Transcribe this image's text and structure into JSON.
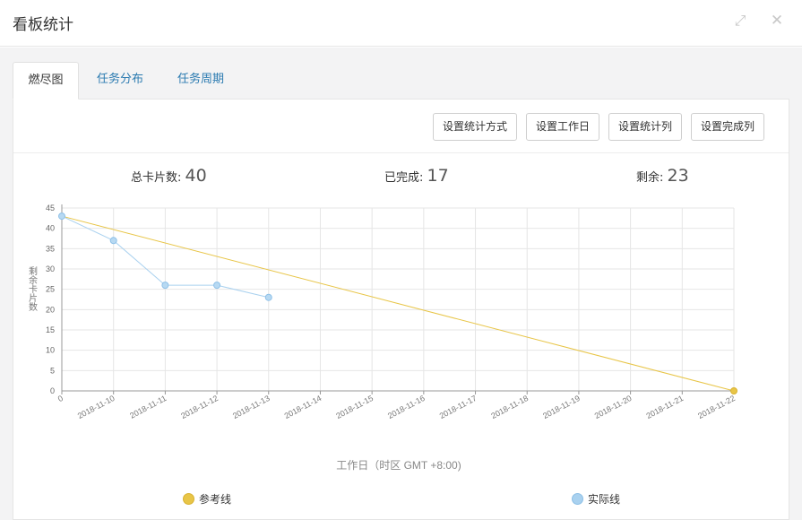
{
  "window": {
    "title": "看板统计",
    "expand_icon": "expand-arrows-icon",
    "close_icon": "close-icon"
  },
  "tabs": [
    {
      "label": "燃尽图",
      "active": true
    },
    {
      "label": "任务分布",
      "active": false
    },
    {
      "label": "任务周期",
      "active": false
    }
  ],
  "toolbar": {
    "stat_method": "设置统计方式",
    "workday": "设置工作日",
    "stat_column": "设置统计列",
    "done_column": "设置完成列"
  },
  "stats": {
    "total_label": "总卡片数:",
    "total_value": "40",
    "done_label": "已完成:",
    "done_value": "17",
    "remaining_label": "剩余:",
    "remaining_value": "23"
  },
  "chart_data": {
    "type": "line",
    "xlabel": "工作日（时区 GMT +8:00)",
    "ylabel": "剩余卡片数",
    "ylim": [
      0,
      45
    ],
    "yticks": [
      0,
      5,
      10,
      15,
      20,
      25,
      30,
      35,
      40,
      45
    ],
    "categories": [
      "0",
      "2018-11-10",
      "2018-11-11",
      "2018-11-12",
      "2018-11-13",
      "2018-11-14",
      "2018-11-15",
      "2018-11-16",
      "2018-11-17",
      "2018-11-18",
      "2018-11-19",
      "2018-11-20",
      "2018-11-21",
      "2018-11-22"
    ],
    "grid": true,
    "legend_position": "bottom",
    "series": [
      {
        "name": "参考线",
        "color": "#e8c547",
        "points": [
          [
            0,
            43
          ],
          [
            13,
            0
          ]
        ]
      },
      {
        "name": "实际线",
        "color": "#a9d1ef",
        "values": [
          43,
          37,
          26,
          26,
          23
        ]
      }
    ]
  }
}
